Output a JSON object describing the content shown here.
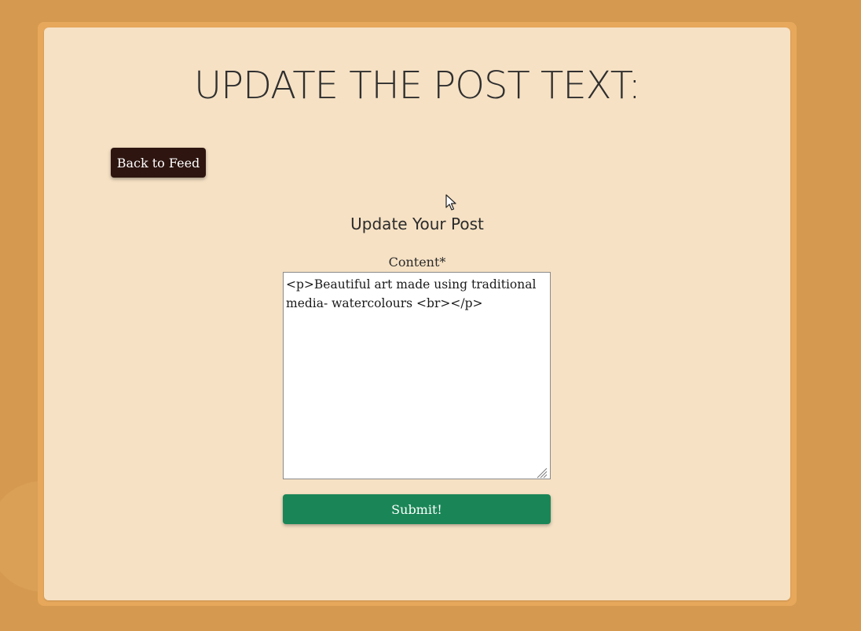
{
  "page": {
    "title": "UPDATE THE POST TEXT:"
  },
  "nav": {
    "back_label": "Back to Feed"
  },
  "form": {
    "heading": "Update Your Post",
    "content_label": "Content*",
    "content_value": "<p>Beautiful art made using traditional media- watercolours <br></p>",
    "submit_label": "Submit!"
  },
  "colors": {
    "background": "#d59a4f",
    "card": "#f6e1c4",
    "back_button": "#2e1510",
    "submit_button": "#1a8657"
  },
  "icons": {
    "cursor": "mouse-pointer-icon",
    "resize": "resize-grip-icon"
  }
}
